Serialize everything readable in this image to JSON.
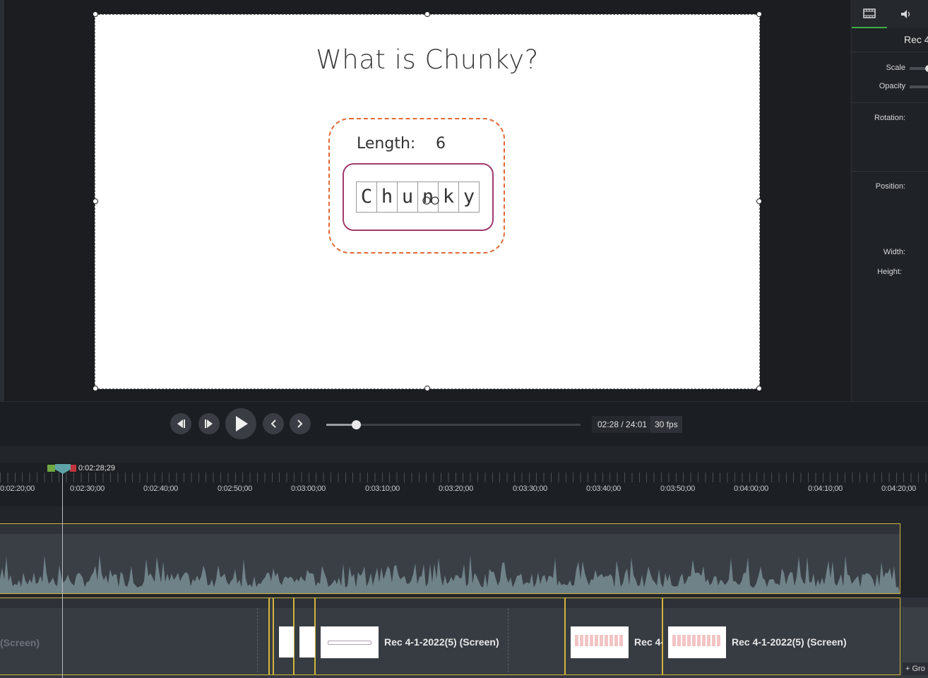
{
  "canvas": {
    "slide_title": "What is Chunky?",
    "length_label": "Length:",
    "length_value": "6",
    "chars": [
      "C",
      "h",
      "u",
      "n",
      "k",
      "y"
    ]
  },
  "properties": {
    "tabs": [
      "visual-properties-icon",
      "audio-properties-icon"
    ],
    "clip_name": "Rec 4",
    "labels": {
      "scale": "Scale",
      "opacity": "Opacity",
      "rotation": "Rotation:",
      "position": "Position:",
      "width": "Width:",
      "height": "Height:"
    }
  },
  "playback": {
    "time": "02:28 / 24:01",
    "fps": "30 fps",
    "progress_fraction": 0.103
  },
  "timeline": {
    "playhead_time": "0:02:28;29",
    "ruler_labels": [
      "0:02:20;00",
      "0:02:30;00",
      "0:02:40;00",
      "0:02:50;00",
      "0:03:00;00",
      "0:03:10;00",
      "0:03:20;00",
      "0:03:30;00",
      "0:03:40;00",
      "0:03:50;00",
      "0:04:00;00",
      "0:04:10;00",
      "0:04:20;00"
    ],
    "clips": {
      "first": "(Screen)",
      "c1": "Rec 4-1-2022(5) (Screen)",
      "c2": "Rec 4-",
      "c3": "Rec 4-1-2022(5) (Screen)"
    },
    "group_tag": "+ Gro"
  },
  "colors": {
    "accent_green": "#3fae49",
    "clip_border": "#d2b43a",
    "slide_dashed_border": "#e06b3a",
    "inner_box_border": "#a13b6c"
  }
}
